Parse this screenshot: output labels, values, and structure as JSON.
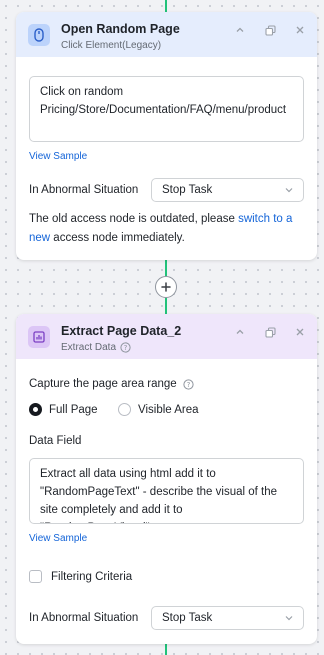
{
  "card1": {
    "title": "Open Random Page",
    "subtitle": "Click Element(Legacy)",
    "textbox_value": "Click on random Pricing/Store/Documentation/FAQ/menu/product",
    "view_sample": "View Sample",
    "abnormal_label": "In Abnormal Situation",
    "abnormal_value": "Stop Task",
    "note_prefix": "The old access node is outdated, please ",
    "note_link": "switch to a new",
    "note_suffix": " access node immediately."
  },
  "card2": {
    "title": "Extract Page Data_2",
    "subtitle": "Extract Data",
    "capture_label": "Capture the page area range",
    "radio_full": "Full Page",
    "radio_visible": "Visible Area",
    "selected_range": "Full Page",
    "data_field_label": "Data Field",
    "data_field_value": "Extract all data using html add it to \"RandomPageText\" - describe the visual of the site completely and add it to \"RandomPageVisual\"",
    "view_sample": "View Sample",
    "filter_label": "Filtering Criteria",
    "abnormal_label": "In Abnormal Situation",
    "abnormal_value": "Stop Task"
  },
  "colors": {
    "accent_link": "#1565d8",
    "connector": "#22c27a",
    "card1_header": "#e5edfd",
    "card2_header": "#efe6fb"
  },
  "icons": [
    "mouse-icon",
    "chart-icon",
    "collapse-icon",
    "copy-icon",
    "close-icon",
    "help-icon",
    "plus-icon",
    "chevron-down-icon"
  ]
}
